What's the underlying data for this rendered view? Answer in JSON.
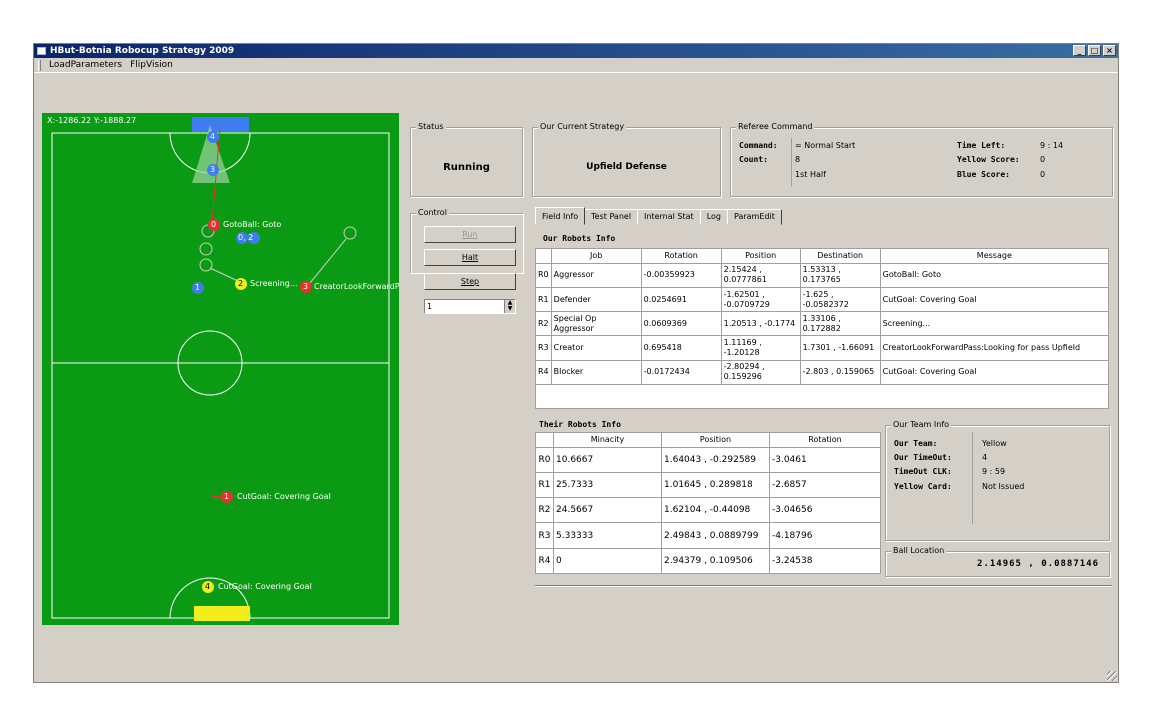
{
  "window": {
    "title": "HBut-Botnia Robocup Strategy 2009",
    "minimize": "_",
    "maximize": "□",
    "close": "×"
  },
  "menu": {
    "load_parameters": "LoadParameters",
    "flip_vision": "FlipVision"
  },
  "field": {
    "coords": "X:-1286.22 Y:-1888.27",
    "colors": {
      "grass": "#0b9a14",
      "blue": "#3e7df0",
      "yellow": "#f2ee1e",
      "red": "#e83030"
    },
    "robot_labels": {
      "r0": "GotoBall: Goto",
      "r1_top": "0",
      "r2": "Screening...",
      "r3": "CreatorLookForwardP",
      "r_low": "CutGoal: Covering Goal",
      "r4": "CutGoal: Covering Goal"
    },
    "robot_numbers": {
      "b4": "4",
      "b3": "3",
      "r0": "0",
      "b02": "0, 2",
      "b1": "1",
      "y2": "2",
      "r3": "3",
      "r1": "1",
      "y4": "4"
    }
  },
  "status": {
    "label": "Status",
    "value": "Running"
  },
  "strategy": {
    "label": "Our Current Strategy",
    "value": "Upfield Defense"
  },
  "referee": {
    "label": "Referee Command",
    "command_key": "Command:",
    "command_val": "= Normal Start",
    "count_key": "Count:",
    "count_val": "8",
    "half": "1st Half",
    "time_left_key": "Time Left:",
    "time_left_val": "9 : 14",
    "yellow_score_key": "Yellow Score:",
    "yellow_score_val": "0",
    "blue_score_key": "Blue Score:",
    "blue_score_val": "0"
  },
  "control": {
    "label": "Control",
    "run": "Run",
    "halt": "Halt",
    "step": "Step",
    "step_value": "1"
  },
  "tabs": [
    "Field Info",
    "Test Panel",
    "Internal Stat",
    "Log",
    "ParamEdit"
  ],
  "our_robots": {
    "title": "Our Robots Info",
    "headers": [
      "Job",
      "Rotation",
      "Position",
      "Destination",
      "Message"
    ],
    "rows": [
      [
        "R0",
        "Aggressor",
        "-0.00359923",
        "2.15424 , 0.0777861",
        "1.53313 , 0.173765",
        "GotoBall: Goto"
      ],
      [
        "R1",
        "Defender",
        "0.0254691",
        "-1.62501 , -0.0709729",
        "-1.625 , -0.0582372",
        "CutGoal: Covering Goal"
      ],
      [
        "R2",
        "Special Op Aggressor",
        "0.0609369",
        "1.20513 , -0.1774",
        "1.33106 , 0.172882",
        "Screening..."
      ],
      [
        "R3",
        "Creator",
        "0.695418",
        "1.11169 , -1.20128",
        "1.7301 , -1.66091",
        "CreatorLookForwardPass:Looking for pass Upfield"
      ],
      [
        "R4",
        "Blocker",
        "-0.0172434",
        "-2.80294 , 0.159296",
        "-2.803 , 0.159065",
        "CutGoal: Covering Goal"
      ]
    ]
  },
  "their_robots": {
    "title": "Their Robots Info",
    "headers": [
      "Minacity",
      "Position",
      "Rotation"
    ],
    "rows": [
      [
        "R0",
        "10.6667",
        "1.64043 , -0.292589",
        "-3.0461"
      ],
      [
        "R1",
        "25.7333",
        "1.01645 , 0.289818",
        "-2.6857"
      ],
      [
        "R2",
        "24.5667",
        "1.62104 , -0.44098",
        "-3.04656"
      ],
      [
        "R3",
        "5.33333",
        "2.49843 , 0.0889799",
        "-4.18796"
      ],
      [
        "R4",
        "0",
        "2.94379 , 0.109506",
        "-3.24538"
      ]
    ]
  },
  "team_info": {
    "label": "Our Team Info",
    "team_key": "Our Team:",
    "team_val": "Yellow",
    "timeout_key": "Our TimeOut:",
    "timeout_val": "4",
    "clk_key": "TimeOut CLK:",
    "clk_val": "9 : 59",
    "card_key": "Yellow Card:",
    "card_val": "Not Issued"
  },
  "ball": {
    "label": "Ball Location",
    "value": "2.14965 , 0.0887146"
  }
}
